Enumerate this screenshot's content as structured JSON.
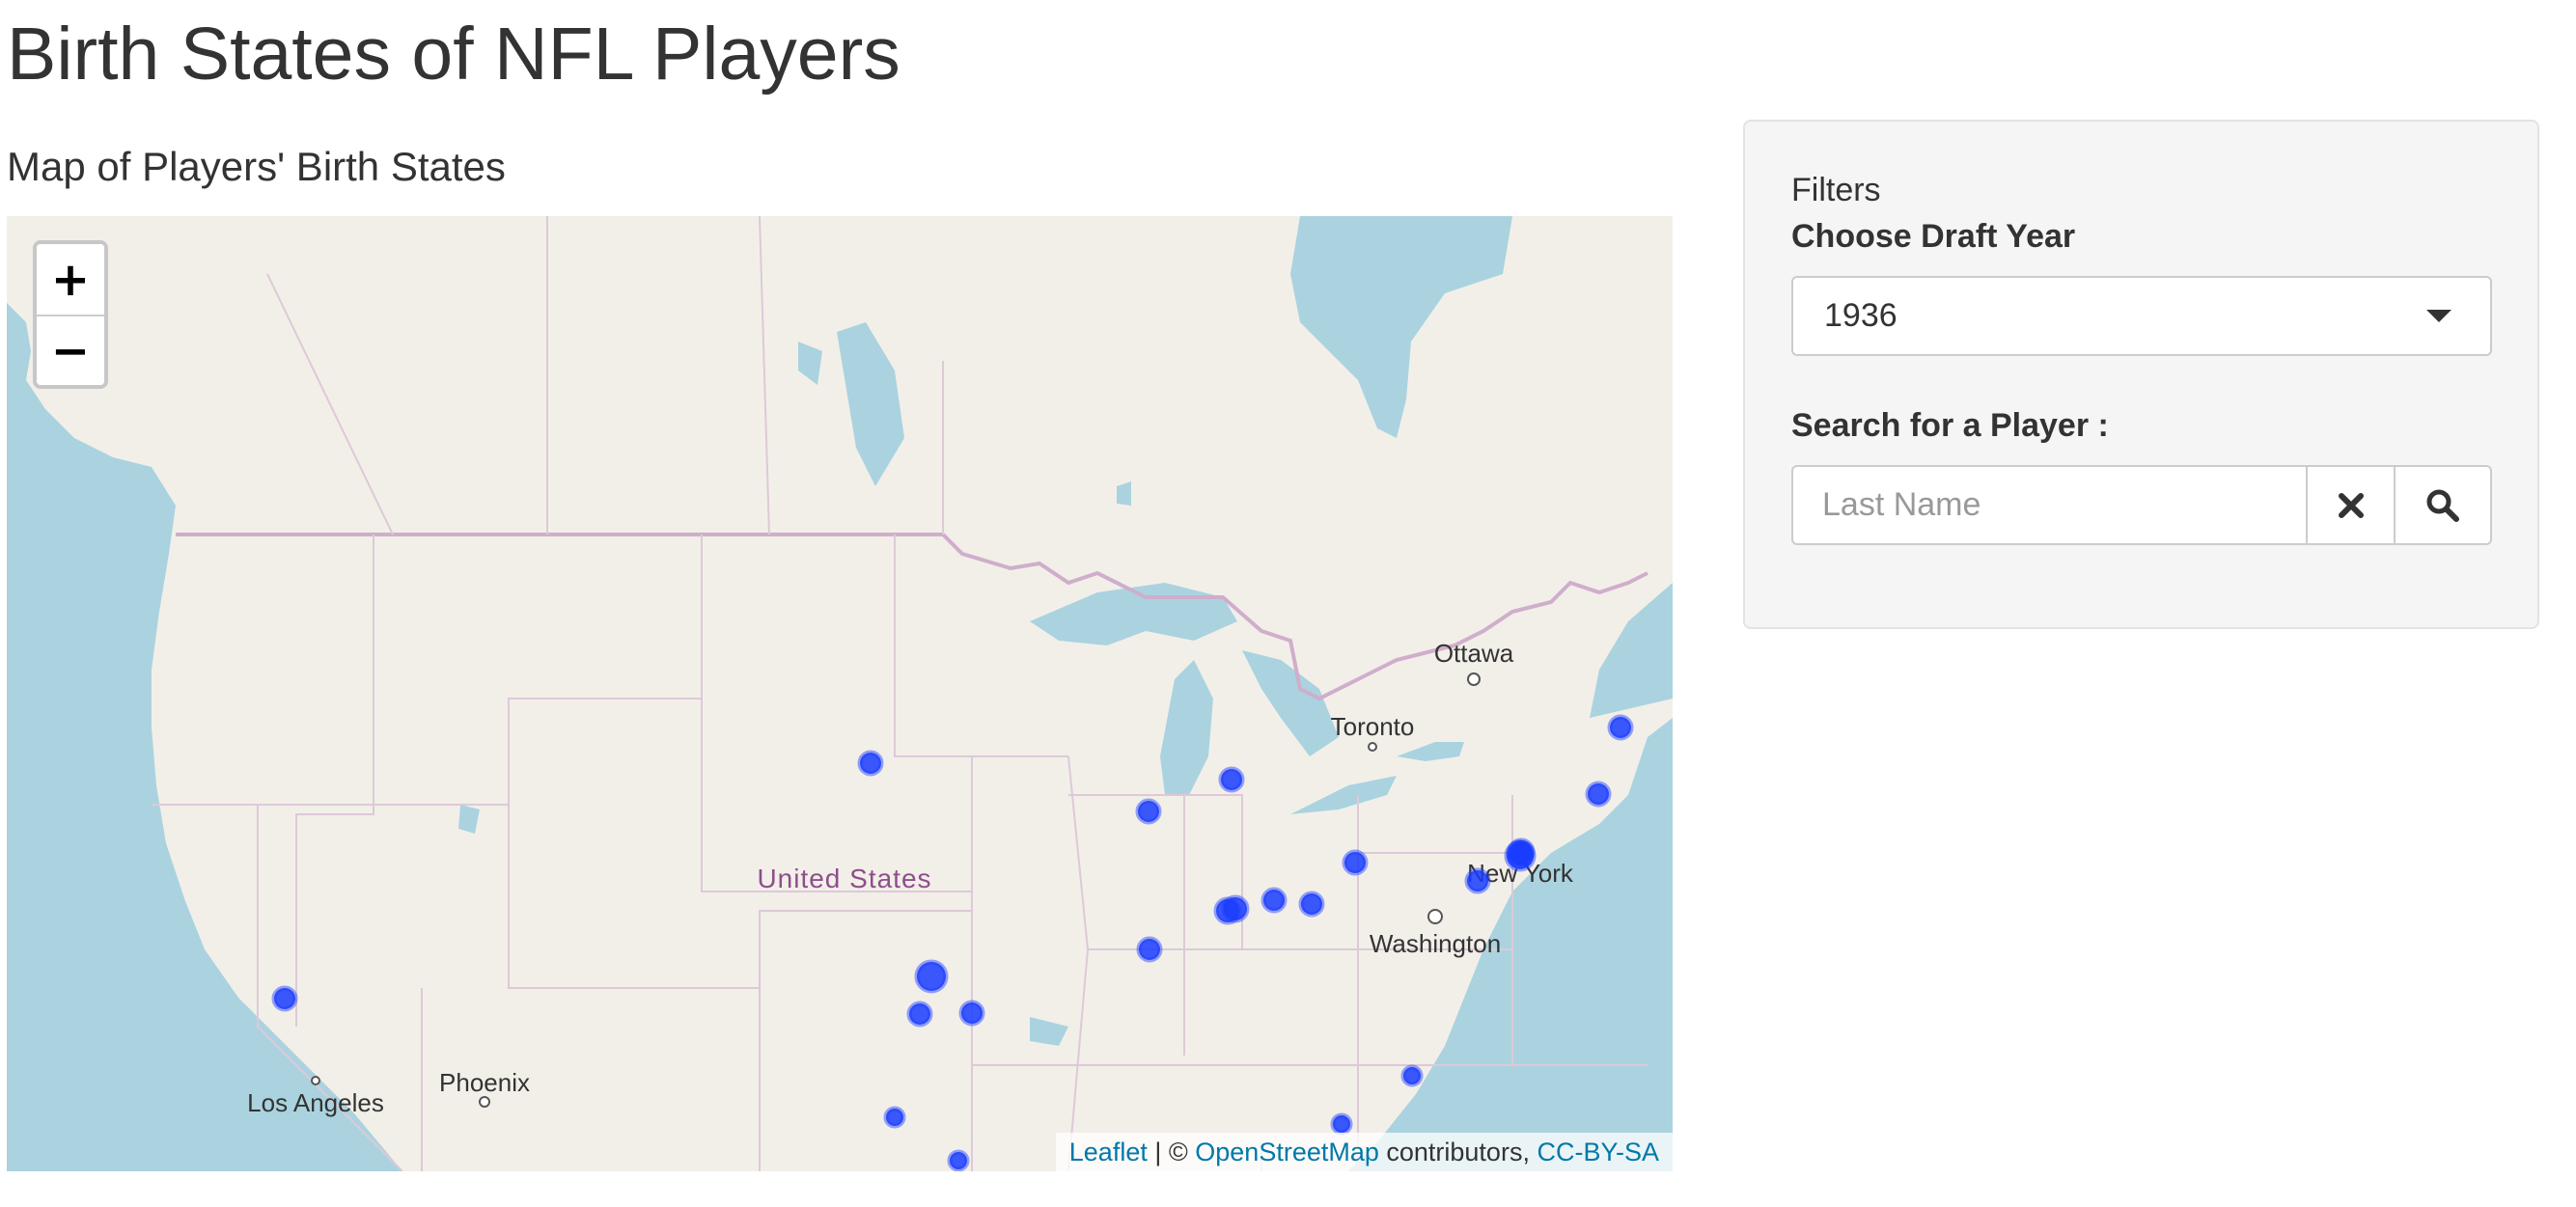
{
  "page": {
    "title": "Birth States of NFL Players",
    "map_heading": "Map of Players' Birth States"
  },
  "map": {
    "zoom_in_label": "+",
    "zoom_out_label": "−",
    "places": {
      "united_states": "United States",
      "ottawa": "Ottawa",
      "toronto": "Toronto",
      "new_york": "New York",
      "washington": "Washington",
      "phoenix": "Phoenix",
      "los_angeles": "Los Angeles"
    },
    "attribution": {
      "leaflet": "Leaflet",
      "separator": " | © ",
      "osm": "OpenStreetMap",
      "contributors": " contributors, ",
      "license": "CC-BY-SA"
    },
    "marker_color": "#1a3cff",
    "marker_count": 23
  },
  "sidebar": {
    "heading": "Filters",
    "draft_year_label": "Choose Draft Year",
    "draft_year_value": "1936",
    "search_label": "Search for a Player :",
    "search_placeholder": "Last Name",
    "clear_icon": "x-icon",
    "search_icon": "search-icon"
  }
}
